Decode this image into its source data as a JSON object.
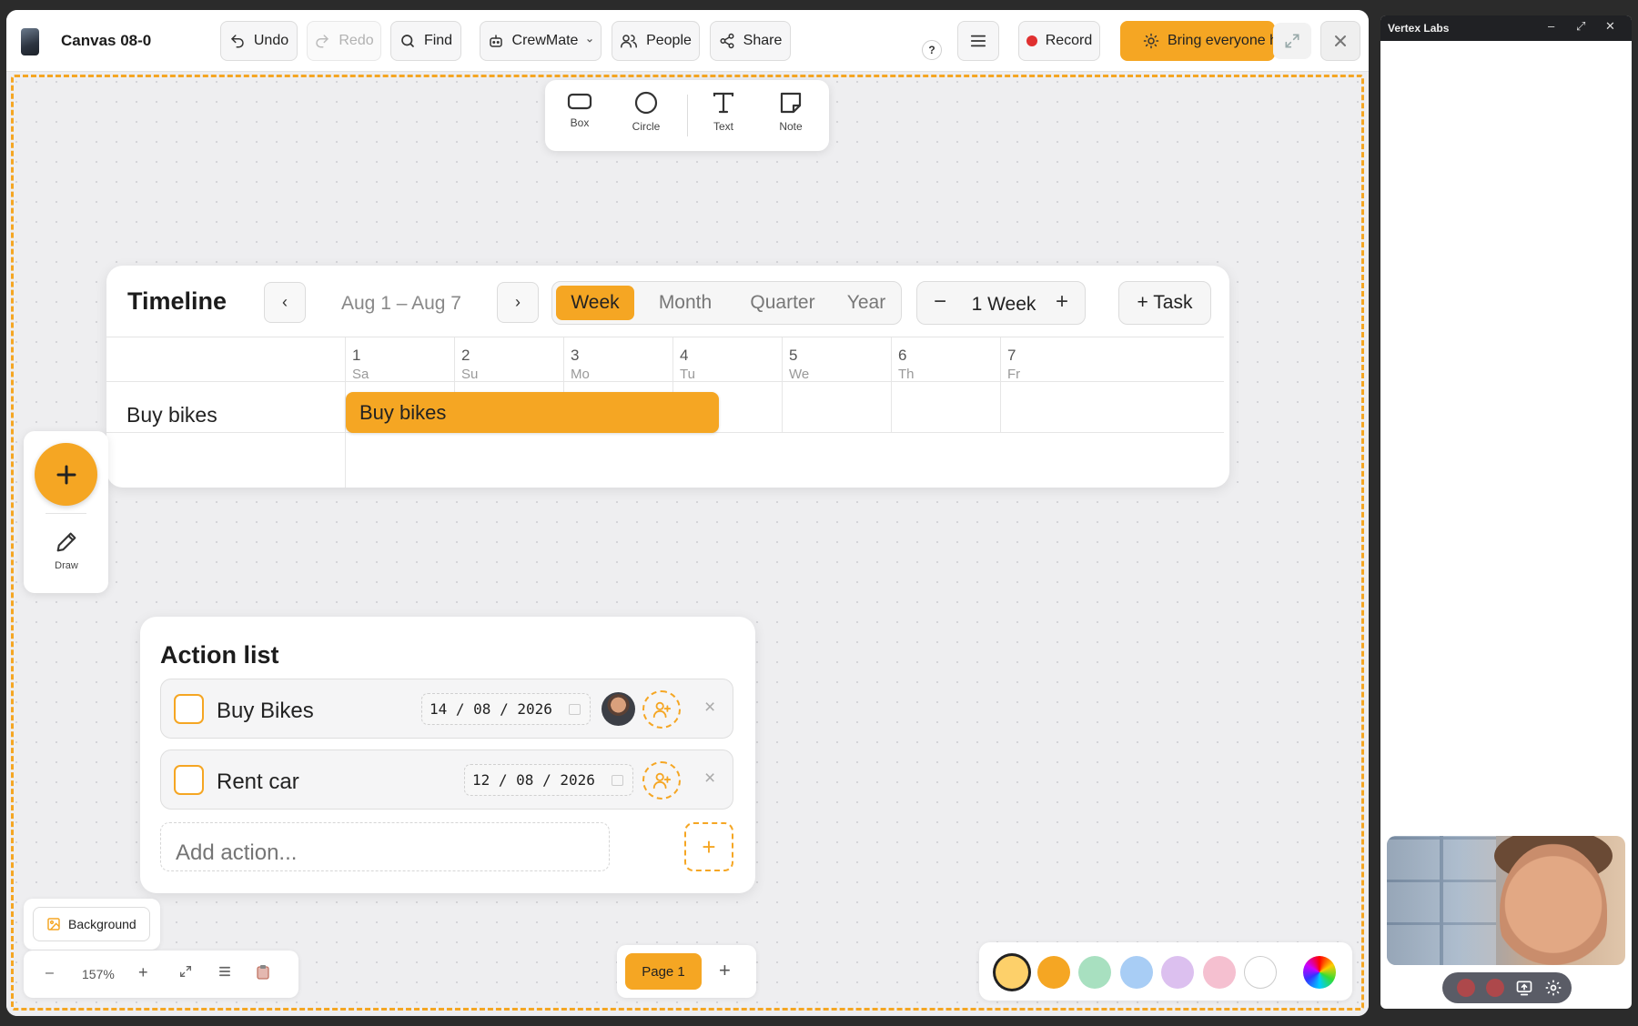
{
  "topbar": {
    "canvas_title": "Canvas 08-0",
    "undo": "Undo",
    "redo": "Redo",
    "find": "Find",
    "crewmate": "CrewMate",
    "people": "People",
    "share": "Share",
    "help": "?",
    "record": "Record",
    "bring": "Bring everyone h"
  },
  "shapes": [
    {
      "label": "Box",
      "icon": "box-icon"
    },
    {
      "label": "Circle",
      "icon": "circle-icon"
    },
    {
      "label": "Text",
      "icon": "text-icon"
    },
    {
      "label": "Note",
      "icon": "note-icon"
    }
  ],
  "timeline": {
    "title": "Timeline",
    "prev": "‹",
    "next": "›",
    "range": "Aug 1 – Aug 7",
    "views": [
      "Week",
      "Month",
      "Quarter",
      "Year"
    ],
    "active_view": "Week",
    "zoom_minus": "−",
    "zoom_label": "1 Week",
    "zoom_plus": "+",
    "add_task": "+ Task",
    "days": [
      {
        "num": "1",
        "name": "Sa"
      },
      {
        "num": "2",
        "name": "Su"
      },
      {
        "num": "3",
        "name": "Mo"
      },
      {
        "num": "4",
        "name": "Tu"
      },
      {
        "num": "5",
        "name": "We"
      },
      {
        "num": "6",
        "name": "Th"
      },
      {
        "num": "7",
        "name": "Fr"
      }
    ],
    "rows": [
      {
        "label": "Buy bikes",
        "bar_label": "Buy bikes"
      }
    ]
  },
  "rail": {
    "add": "+",
    "draw": "Draw"
  },
  "actions": {
    "title": "Action list",
    "items": [
      {
        "label": "Buy Bikes",
        "date": "14 / 08 / 2026",
        "remove": "×"
      },
      {
        "label": "Rent car",
        "date": "12 / 08 / 2026",
        "remove": "×"
      }
    ],
    "add_placeholder": "Add action...",
    "add_btn": "+"
  },
  "bottom": {
    "background": "Background",
    "zoom_minus": "–",
    "zoom": "157%",
    "zoom_plus": "+",
    "page": "Page 1",
    "page_add": "+"
  },
  "colors": {
    "accent": "#f5a623",
    "swatches": [
      "#fdd06a",
      "#f5a623",
      "#a8e0c0",
      "#a8cdf5",
      "#dcc0ef",
      "#f5c0d0",
      "#ffffff"
    ]
  },
  "side": {
    "title": "Vertex Labs",
    "minimize": "–",
    "maximize": "⤢",
    "close": "✕"
  }
}
